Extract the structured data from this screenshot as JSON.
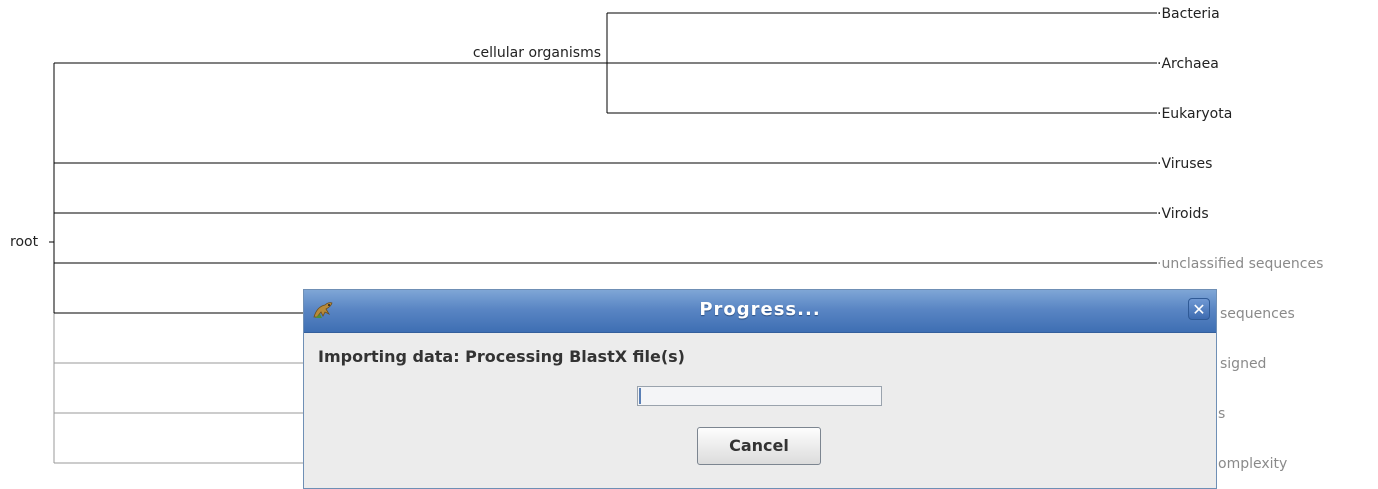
{
  "tree": {
    "root_label": "root",
    "inner_label": "cellular organisms",
    "leaves": [
      "Bacteria",
      "Archaea",
      "Eukaryota",
      "Viruses",
      "Viroids",
      "unclassified sequences",
      "sequences",
      "signed",
      "s",
      "omplexity"
    ]
  },
  "dialog": {
    "title": "Progress...",
    "close_symbol": "✕",
    "message": "Importing data: Processing BlastX file(s)",
    "progress_fraction": 0.01,
    "cancel_label": "Cancel"
  },
  "colors": {
    "titlebar": "#4f7fc0",
    "progress_fill": "#5a7fb5"
  },
  "icons": {
    "app": "megan-icon",
    "close": "close-icon"
  }
}
